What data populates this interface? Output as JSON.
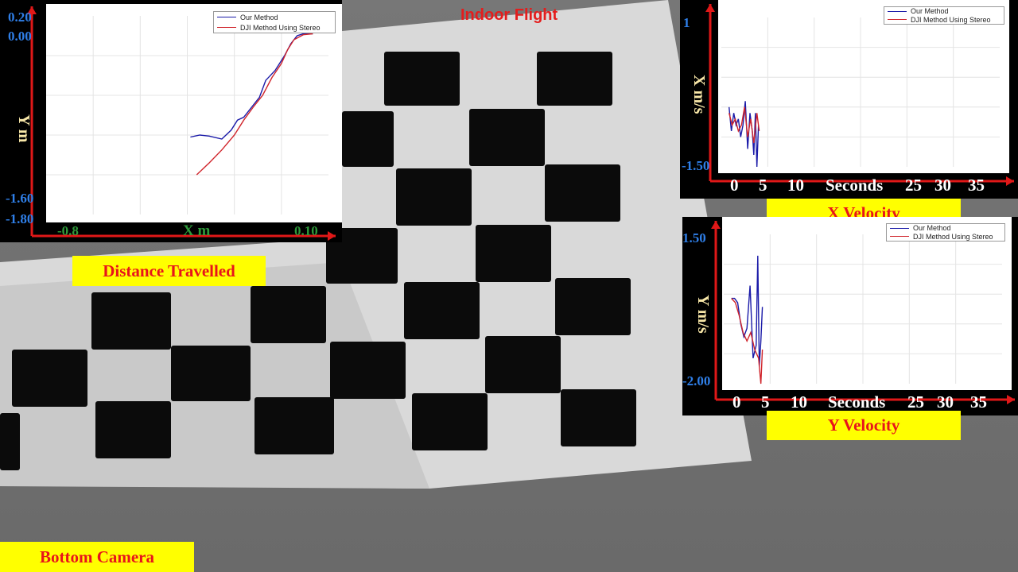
{
  "title": "Indoor Flight",
  "camera_label": "Bottom Camera",
  "colors": {
    "our_method": "#1a1aa8",
    "dji_method": "#d0242b",
    "axis_red": "#e01818",
    "label_bg": "#ffff00"
  },
  "charts": {
    "distance": {
      "caption": "Distance Travelled",
      "xlabel": "X m",
      "ylabel": "Y m",
      "y_ticks": [
        "0.20",
        "0.00",
        "-1.60",
        "-1.80"
      ],
      "x_ticks": [
        "-0.8",
        "0.10"
      ],
      "legend": [
        "Our Method",
        "DJI Method Using Stereo"
      ]
    },
    "xvel": {
      "caption": "X Velocity",
      "xlabel": "Seconds",
      "ylabel": "X m/s",
      "y_ticks": [
        "1",
        "-1.50"
      ],
      "x_ticks": [
        "0",
        "5",
        "10",
        "25",
        "30",
        "35"
      ],
      "legend": [
        "Our Method",
        "DJI Method Using Stereo"
      ]
    },
    "yvel": {
      "caption": "Y Velocity",
      "xlabel": "Seconds",
      "ylabel": "Y m/s",
      "y_ticks": [
        "1.50",
        "-2.00"
      ],
      "x_ticks": [
        "0",
        "5",
        "10",
        "25",
        "30",
        "35"
      ],
      "legend": [
        "Our Method",
        "DJI Method Using Stereo"
      ]
    }
  },
  "chart_data": [
    {
      "type": "line",
      "title": "Distance Travelled",
      "xlabel": "X m",
      "ylabel": "Y m",
      "xlim": [
        -0.8,
        0.1
      ],
      "ylim": [
        -1.8,
        0.2
      ],
      "series": [
        {
          "name": "Our Method",
          "x": [
            -0.34,
            -0.31,
            -0.28,
            -0.24,
            -0.21,
            -0.19,
            -0.17,
            -0.14,
            -0.12,
            -0.1,
            -0.07,
            -0.04,
            -0.02,
            0.0,
            0.02,
            0.05
          ],
          "y": [
            -1.02,
            -1.0,
            -1.01,
            -1.04,
            -0.95,
            -0.85,
            -0.82,
            -0.7,
            -0.62,
            -0.45,
            -0.35,
            -0.2,
            -0.08,
            0.0,
            0.02,
            0.02
          ]
        },
        {
          "name": "DJI Method Using Stereo",
          "x": [
            -0.32,
            -0.28,
            -0.24,
            -0.2,
            -0.17,
            -0.14,
            -0.11,
            -0.08,
            -0.05,
            -0.03,
            -0.01,
            0.02,
            0.05
          ],
          "y": [
            -1.4,
            -1.28,
            -1.15,
            -1.0,
            -0.85,
            -0.72,
            -0.6,
            -0.42,
            -0.28,
            -0.14,
            -0.04,
            0.01,
            0.02
          ]
        }
      ]
    },
    {
      "type": "line",
      "title": "X Velocity",
      "xlabel": "Seconds",
      "ylabel": "X m/s",
      "xlim": [
        -1,
        35
      ],
      "ylim": [
        -1.5,
        1
      ],
      "series": [
        {
          "name": "Our Method",
          "x": [
            0,
            0.3,
            0.6,
            0.9,
            1.2,
            1.5,
            1.8,
            2.1,
            2.4,
            2.7,
            3.0,
            3.2,
            3.4,
            3.6,
            3.8
          ],
          "y": [
            -0.5,
            -0.9,
            -0.6,
            -0.8,
            -0.7,
            -1.0,
            -0.8,
            -0.4,
            -1.2,
            -0.6,
            -0.9,
            -1.3,
            -0.6,
            -1.5,
            -0.8
          ]
        },
        {
          "name": "DJI Method Using Stereo",
          "x": [
            0,
            0.4,
            0.8,
            1.2,
            1.6,
            2.0,
            2.4,
            2.8,
            3.2,
            3.6,
            3.9
          ],
          "y": [
            -0.6,
            -0.8,
            -0.7,
            -0.9,
            -0.8,
            -0.5,
            -1.0,
            -0.7,
            -1.1,
            -0.6,
            -0.9
          ]
        }
      ]
    },
    {
      "type": "line",
      "title": "Y Velocity",
      "xlabel": "Seconds",
      "ylabel": "Y m/s",
      "xlim": [
        -1,
        35
      ],
      "ylim": [
        -2,
        1.5
      ],
      "series": [
        {
          "name": "Our Method",
          "x": [
            0,
            0.4,
            0.8,
            1.2,
            1.6,
            2.0,
            2.4,
            2.8,
            3.2,
            3.4,
            3.6,
            3.8,
            4.0
          ],
          "y": [
            0.0,
            0.0,
            -0.1,
            -0.6,
            -0.9,
            -0.7,
            0.3,
            -1.4,
            -1.1,
            1.0,
            -1.6,
            -1.0,
            -0.2
          ]
        },
        {
          "name": "DJI Method Using Stereo",
          "x": [
            0,
            0.5,
            1.0,
            1.5,
            2.0,
            2.5,
            3.0,
            3.5,
            3.8,
            4.0
          ],
          "y": [
            0.0,
            -0.1,
            -0.4,
            -0.8,
            -1.0,
            -0.8,
            -1.2,
            -1.4,
            -2.0,
            -1.2
          ]
        }
      ]
    }
  ]
}
